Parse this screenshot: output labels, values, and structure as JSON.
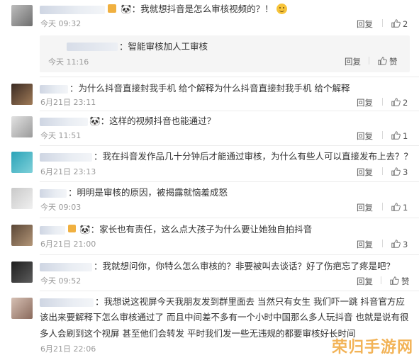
{
  "comments": [
    {
      "text": "🐼：我就想抖音是怎么审核视频的？！",
      "time": "今天 09:32",
      "reply_label": "回复",
      "likes": "2",
      "reply": {
        "text": "：智能审核加人工审核",
        "time": "今天 11:16",
        "reply_label": "回复",
        "like_label": "赞"
      }
    },
    {
      "text": "：为什么抖音直接封我手机 给个解释为什么抖音直接封我手机 给个解释",
      "time": "6月21日 23:11",
      "reply_label": "回复",
      "likes": "2"
    },
    {
      "text": "🐼：这样的视频抖音也能通过？",
      "time": "今天 11:51",
      "reply_label": "回复",
      "likes": "1"
    },
    {
      "text": "：我在抖音发作品几十分钟后才能通过审核，为什么有些人可以直接发布上去？？",
      "time": "6月21日 23:13",
      "reply_label": "回复",
      "likes": "3"
    },
    {
      "text": "：明明是审核的原因，被揭露就恼羞成怒",
      "time": "今天 09:03",
      "reply_label": "回复",
      "likes": "1"
    },
    {
      "text": "🐼：家长也有责任，这么点大孩子为什么要让她独自拍抖音",
      "time": "6月21日 21:00",
      "reply_label": "回复",
      "likes": "3"
    },
    {
      "text": "：我就想问你，你特么怎么审核的？非要被叫去谈话？好了伤疤忘了疼是吧？",
      "time": "今天 09:52",
      "reply_label": "回复",
      "like_label": "赞"
    },
    {
      "line1": "：我想说这视屏今天我朋友发到群里面去  当然只有女生  我们吓一跳  抖音官方应",
      "line2": "该出来要解释下怎么审核通过了     而且中间差不多有一个小时中国那么多人玩抖音  也就是说有很",
      "line3": "多人会刷到这个视屏   甚至他们会转发   平时我们发一些无违规的都要审核好长时间",
      "time": "6月21日 22:06"
    }
  ],
  "watermark": "荣归手游网",
  "colors": {
    "link": "#eb7350",
    "emoji": "#f7c43a",
    "watermark": "#f0a63a"
  },
  "icons": {
    "like": "thumbs-up-icon",
    "vip": "vip-badge-icon",
    "panda": "panda-emoji-icon"
  }
}
